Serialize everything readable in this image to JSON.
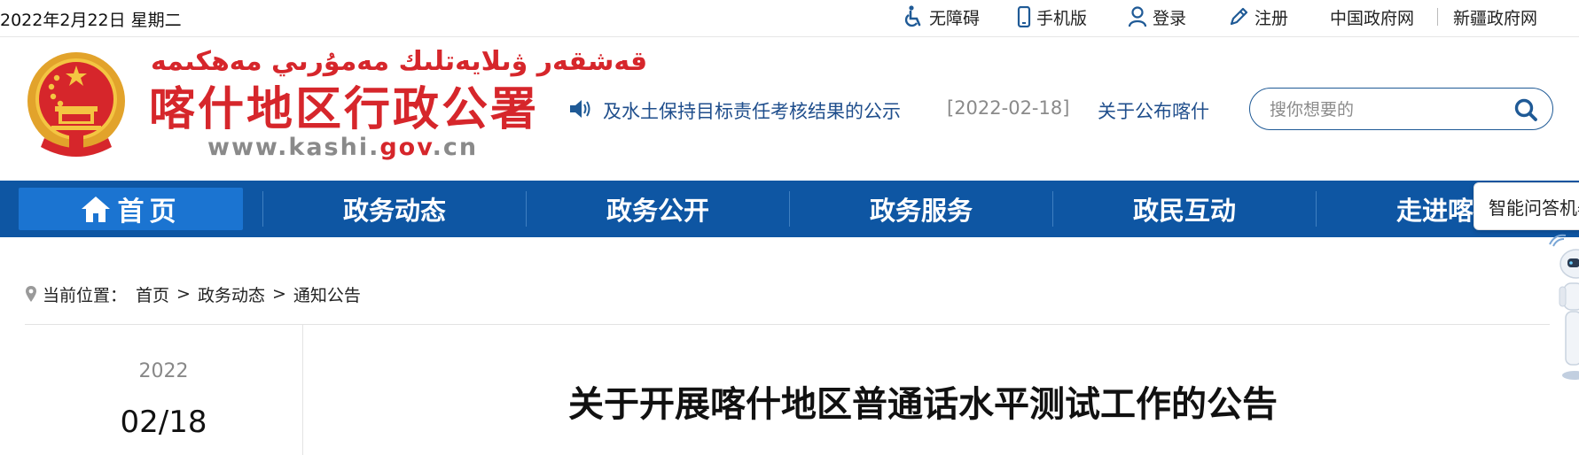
{
  "topbar": {
    "date": "2022年2月22日 星期二",
    "links": {
      "accessibility": "无障碍",
      "mobile": "手机版",
      "login": "登录",
      "register": "注册",
      "china_gov": "中国政府网",
      "xinjiang_gov": "新疆政府网"
    }
  },
  "header": {
    "logo_uyghur": "قەشقەر ۋىلايەتلىك مەمۇرىي مەھكىمە",
    "logo_chinese": "喀什地区行政公署",
    "logo_url_prefix": "www.kashi.",
    "logo_url_gov": "gov",
    "logo_url_suffix": ".cn"
  },
  "ticker": {
    "item1": "及水土保持目标责任考核结果的公示",
    "date2": "[2022-02-18]",
    "item2": "关于公布喀什"
  },
  "search": {
    "placeholder": "搜你想要的"
  },
  "nav": {
    "home": "首页",
    "items": [
      "政务动态",
      "政务公开",
      "政务服务",
      "政民互动",
      "走进喀什"
    ]
  },
  "breadcrumb": {
    "label": "当前位置：",
    "items": [
      "首页",
      "政务动态",
      "通知公告"
    ],
    "separator": ">"
  },
  "article": {
    "year": "2022",
    "month_day": "02/18",
    "title": "关于开展喀什地区普通话水平测试工作的公告"
  },
  "robot": {
    "tooltip": "智能问答机器人"
  },
  "colors": {
    "nav_bg": "#0e56a3",
    "nav_active": "#1b74d1",
    "logo_red": "#d6262b",
    "link_blue": "#1f4e8c"
  }
}
